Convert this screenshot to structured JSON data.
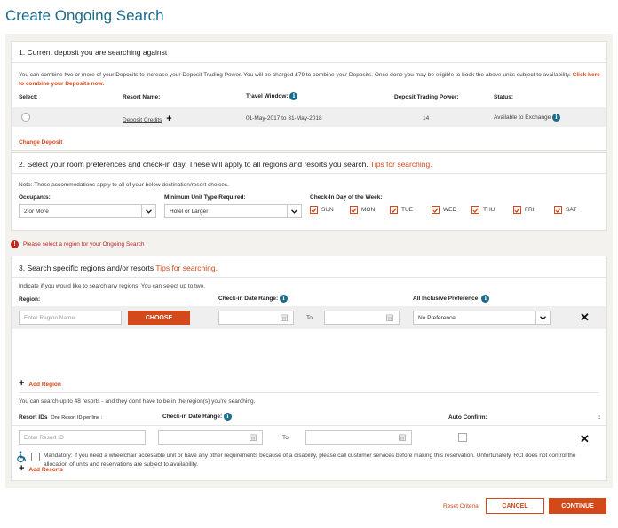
{
  "page_title": "Create Ongoing Search",
  "section1": {
    "title": "1. Current deposit you are searching against",
    "note_text": "You can combine two or more of your Deposits to increase your Deposit Trading Power. You will be charged £79 to combine your Deposits. Once done you may be eligible to book the above units subject to availability.",
    "note_link": "Click here to combine your Deposits now.",
    "headers": {
      "select": "Select:",
      "resort_name": "Resort Name:",
      "travel_window": "Travel Window:",
      "trading_power": "Deposit Trading Power:",
      "status": "Status:"
    },
    "row": {
      "resort_name": "Deposit Credits",
      "travel_window": "01-May-2017 to 31-May-2018",
      "trading_power": "14",
      "status": "Available to Exchange"
    },
    "change_deposit": "Change Deposit"
  },
  "section2": {
    "title": "2. Select your room preferences and check-in day. These will apply to all regions and resorts you search.",
    "tips": "Tips for searching.",
    "note": "Note: These accommodations apply to all of your below destination/resort choices.",
    "occupants_label": "Occupants:",
    "occupants_value": "2 or More",
    "unit_type_label": "Minimum Unit Type Required:",
    "unit_type_value": "Hotel or Larger",
    "checkin_day_label": "Check-In Day of the Week:",
    "days": [
      "SUN",
      "MON",
      "TUE",
      "WED",
      "THU",
      "FRI",
      "SAT"
    ]
  },
  "error_message": "Please select a region for your Ongoing Search",
  "section3": {
    "title": "3. Search specific regions and/or resorts",
    "tips": "Tips for searching.",
    "indicate_text": "Indicate if you would like to search any regions. You can select up to two.",
    "region_label": "Region:",
    "checkin_range_label": "Check-in Date Range:",
    "all_inclusive_label": "All Inclusive Preference:",
    "region_placeholder": "Enter Region Name",
    "choose_button": "CHOOSE",
    "to_text": "To",
    "all_inclusive_value": "No Preference",
    "add_region": "Add Region",
    "resorts_text": "You can search up to 48 resorts - and they don't have to be in the region(s) you're searching.",
    "resort_ids_label": "Resort IDs",
    "resort_ids_hint": "One Resort ID per line :",
    "resort_checkin_label": "Check-in Date Range:",
    "auto_confirm_label": "Auto Confirm:",
    "colon": ":",
    "resort_placeholder": "Enter Resort ID",
    "to_text2": "To",
    "add_resorts": "Add Resorts",
    "mandatory_text": "Mandatory: If you need a wheelchair accessible unit or have any other requirements because of a disability, please call customer services before making this reservation.  Unfortunately, RCI does not control the allocation of units and reservations are subject to availability."
  },
  "footer": {
    "reset": "Reset Criteria",
    "cancel": "CANCEL",
    "continue": "CONTINUE"
  },
  "colors": {
    "accent": "#d4491a",
    "brand": "#1b6b8c",
    "background": "#f3f2ef"
  }
}
